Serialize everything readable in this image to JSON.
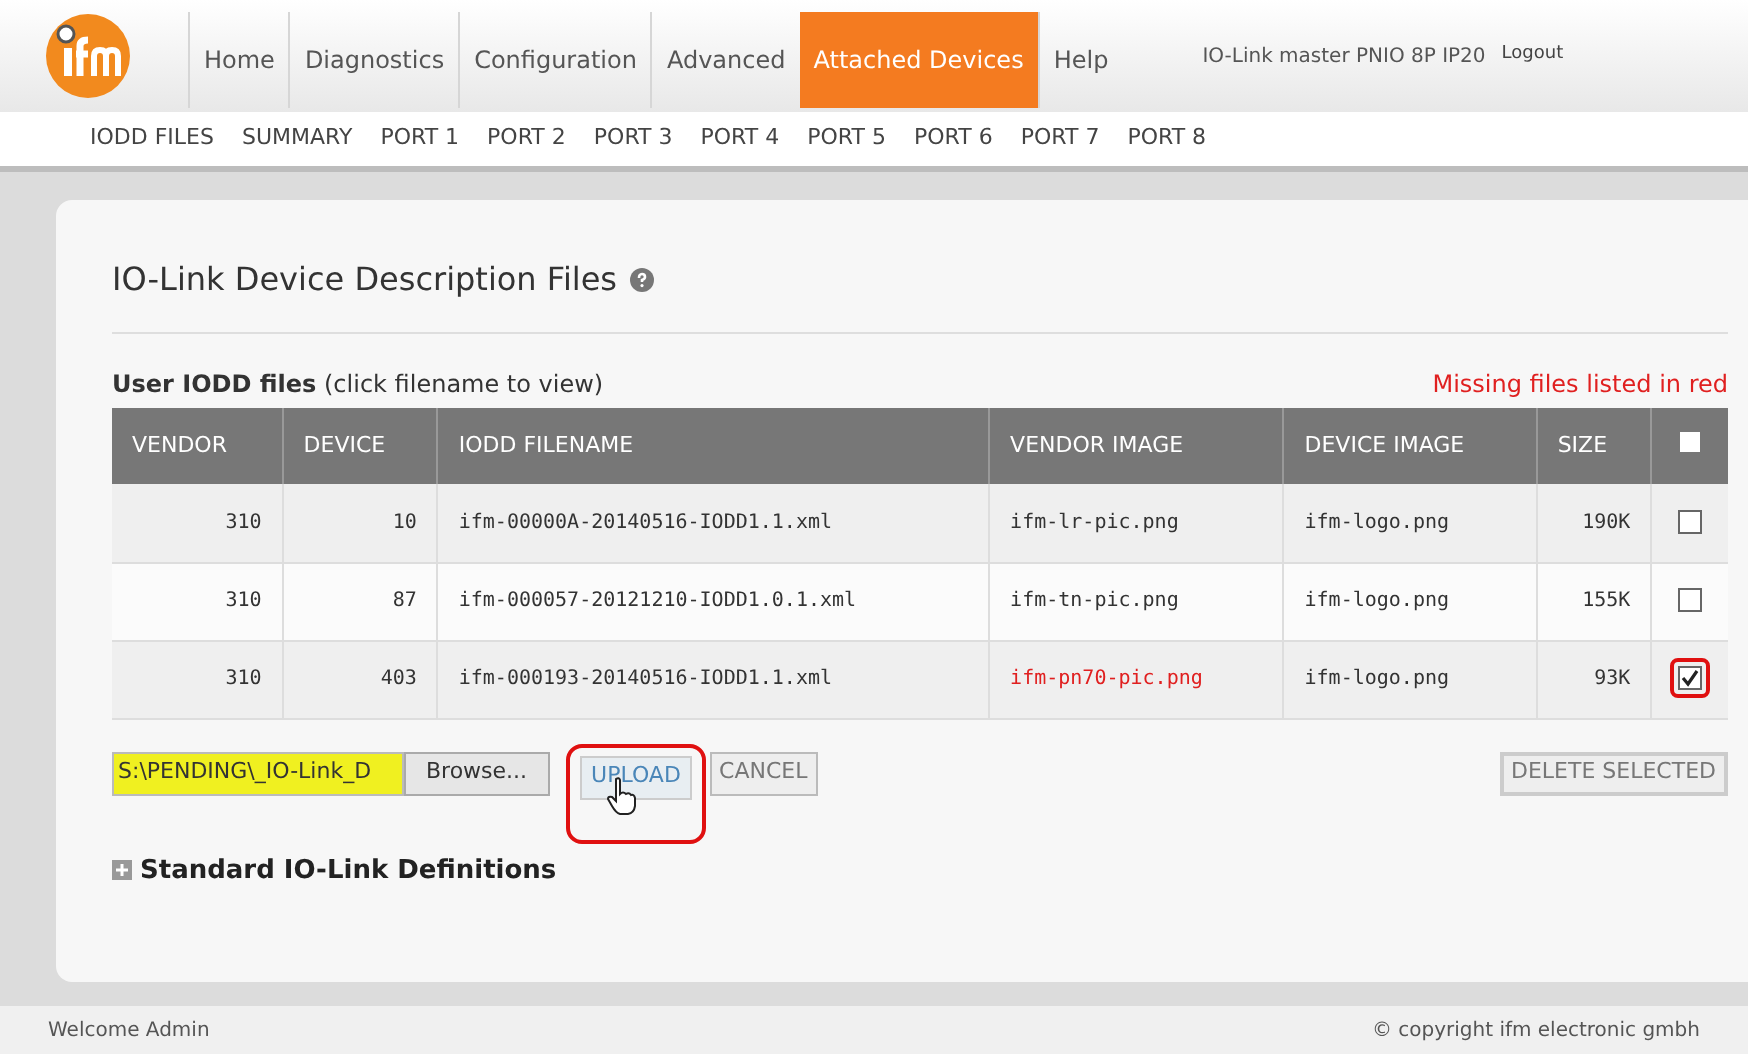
{
  "nav": {
    "tabs": [
      {
        "label": "Home",
        "selected": false
      },
      {
        "label": "Diagnostics",
        "selected": false
      },
      {
        "label": "Configuration",
        "selected": false
      },
      {
        "label": "Advanced",
        "selected": false
      },
      {
        "label": "Attached Devices",
        "selected": true
      },
      {
        "label": "Help",
        "selected": false
      }
    ],
    "device_name": "IO-Link master PNIO 8P IP20",
    "logout": "Logout"
  },
  "subnav": [
    "IODD FILES",
    "SUMMARY",
    "PORT 1",
    "PORT 2",
    "PORT 3",
    "PORT 4",
    "PORT 5",
    "PORT 6",
    "PORT 7",
    "PORT 8"
  ],
  "title": "IO-Link Device Description Files",
  "section_label": "**User IODD files** (click filename to view)",
  "missing_note": "Missing files listed in red",
  "table": {
    "columns": [
      "VENDOR",
      "DEVICE",
      "IODD FILENAME",
      "VENDOR IMAGE",
      "DEVICE IMAGE",
      "SIZE"
    ],
    "select_all": {
      "checked": false
    },
    "rows": [
      {
        "vendor": "310",
        "device": "10",
        "filename": "ifm-00000A-20140516-IODD1.1.xml",
        "vendor_image": "ifm-lr-pic.png",
        "vendor_image_missing": false,
        "device_image": "ifm-logo.png",
        "size": "190K",
        "checked": false,
        "highlighted": false
      },
      {
        "vendor": "310",
        "device": "87",
        "filename": "ifm-000057-20121210-IODD1.0.1.xml",
        "vendor_image": "ifm-tn-pic.png",
        "vendor_image_missing": false,
        "device_image": "ifm-logo.png",
        "size": "155K",
        "checked": false,
        "highlighted": false
      },
      {
        "vendor": "310",
        "device": "403",
        "filename": "ifm-000193-20140516-IODD1.1.xml",
        "vendor_image": "ifm-pn70-pic.png",
        "vendor_image_missing": true,
        "device_image": "ifm-logo.png",
        "size": "93K",
        "checked": true,
        "highlighted": true
      }
    ]
  },
  "file_field": {
    "value": "S:\\PENDING\\_IO-Link_D"
  },
  "buttons": {
    "browse": "Browse...",
    "upload": "UPLOAD",
    "cancel": "CANCEL",
    "delete": "DELETE SELECTED"
  },
  "standard_definitions": {
    "label": "Standard IO-Link Definitions",
    "expanded": false
  },
  "footer": {
    "welcome": "Welcome Admin",
    "copyright": "© copyright ifm electronic gmbh"
  }
}
